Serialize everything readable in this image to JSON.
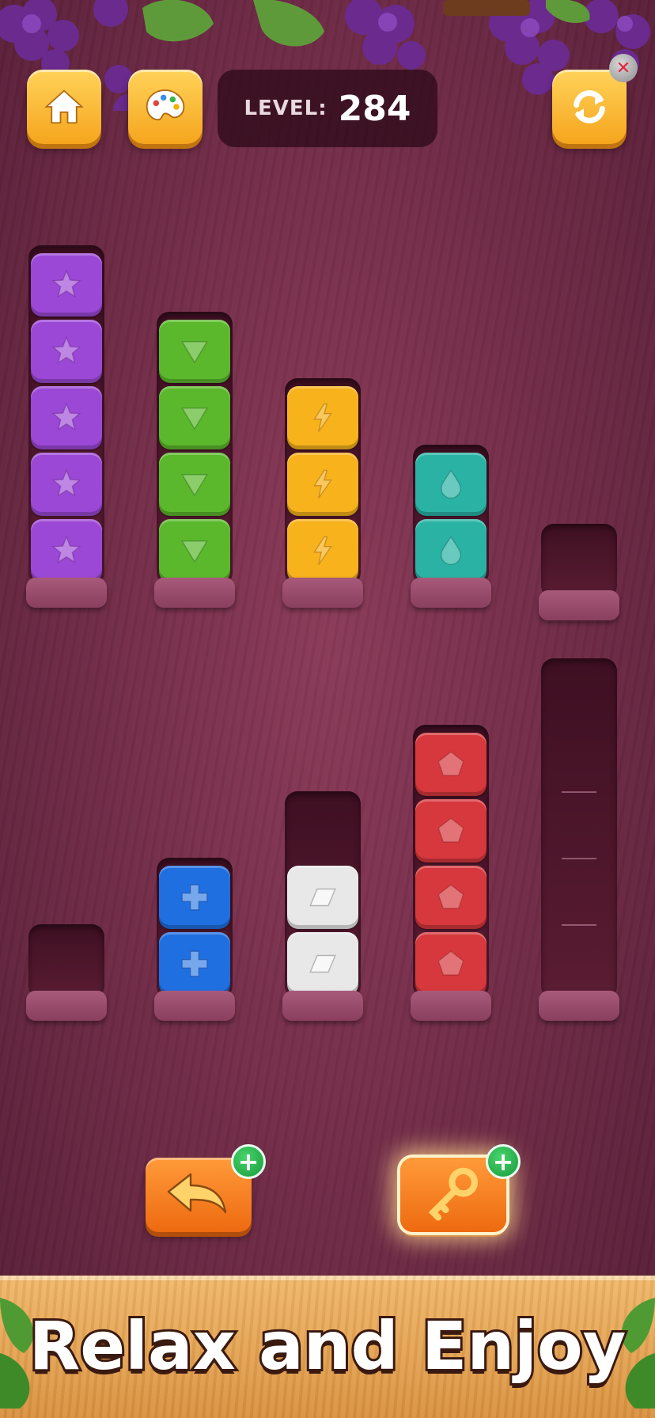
{
  "hud": {
    "home_icon": "home-icon",
    "palette_icon": "palette-icon",
    "level_label": "LEVEL:",
    "level_value": "284",
    "restart_icon": "restart-icon",
    "close_icon": "close-icon"
  },
  "colors": {
    "purple": "#9b48d6",
    "green": "#5bb82c",
    "yellow": "#f7b21c",
    "teal": "#2ab3a4",
    "blue": "#1f6fe0",
    "white": "#e8e8e8",
    "red": "#d6383d"
  },
  "tubes": [
    {
      "id": "tube-1",
      "capacity": 5,
      "blocks": [
        "purple",
        "purple",
        "purple",
        "purple",
        "purple"
      ],
      "symbol": "star"
    },
    {
      "id": "tube-2",
      "capacity": 4,
      "blocks": [
        "green",
        "green",
        "green",
        "green"
      ],
      "symbol": "triangle"
    },
    {
      "id": "tube-3",
      "capacity": 3,
      "blocks": [
        "yellow",
        "yellow",
        "yellow"
      ],
      "symbol": "lightning"
    },
    {
      "id": "tube-4",
      "capacity": 2,
      "blocks": [
        "teal",
        "teal"
      ],
      "symbol": "drop"
    },
    {
      "id": "tube-5",
      "capacity": 1,
      "blocks": [],
      "symbol": ""
    },
    {
      "id": "tube-6",
      "capacity": 1,
      "blocks": [],
      "symbol": ""
    },
    {
      "id": "tube-7",
      "capacity": 2,
      "blocks": [
        "blue",
        "blue"
      ],
      "symbol": "plus"
    },
    {
      "id": "tube-8",
      "capacity": 3,
      "blocks": [
        "white",
        "white"
      ],
      "symbol": "parallelogram"
    },
    {
      "id": "tube-9",
      "capacity": 4,
      "blocks": [
        "red",
        "red",
        "red",
        "red"
      ],
      "symbol": "pentagon"
    },
    {
      "id": "tube-10",
      "capacity": 5,
      "blocks": [],
      "symbol": ""
    }
  ],
  "actions": {
    "undo_icon": "undo-arrow-icon",
    "key_icon": "key-icon",
    "plus": "+"
  },
  "banner": {
    "text": "Relax and Enjoy"
  }
}
